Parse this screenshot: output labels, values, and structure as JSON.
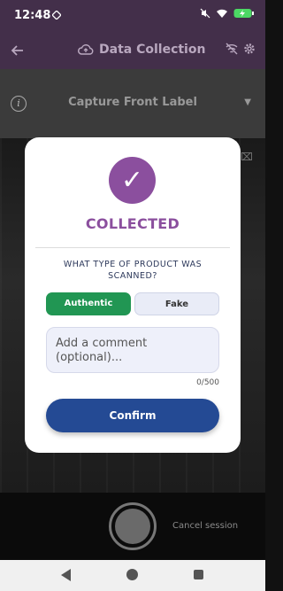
{
  "status_bar": {
    "time": "12:48"
  },
  "app_bar": {
    "title": "Data Collection"
  },
  "sub_header": {
    "title": "Capture Front Label"
  },
  "dialog": {
    "title": "COLLECTED",
    "question": "WHAT TYPE OF PRODUCT WAS SCANNED?",
    "options": {
      "authentic": "Authentic",
      "fake": "Fake"
    },
    "selected": "authentic",
    "comment_placeholder": "Add a comment (optional)...",
    "char_count": "0/500",
    "confirm_label": "Confirm"
  },
  "capture": {
    "cancel_label": "Cancel session"
  },
  "colors": {
    "app_bar": "#432f4a",
    "accent": "#8b4f9e",
    "authentic": "#219653",
    "confirm": "#244a94"
  }
}
